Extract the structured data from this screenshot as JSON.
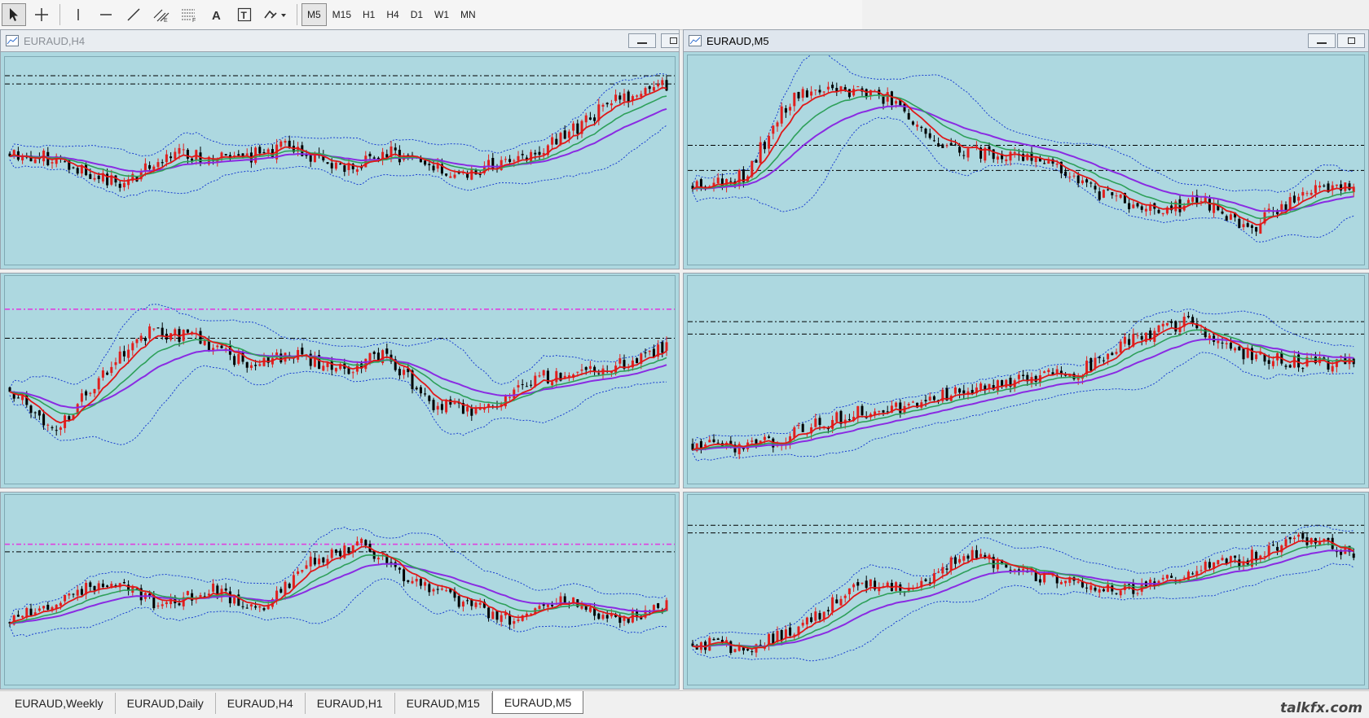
{
  "toolbar": {
    "tools": [
      {
        "name": "cursor-tool",
        "icon": "arrow-cursor-icon",
        "active": true
      },
      {
        "name": "crosshair-tool",
        "icon": "crosshair-icon",
        "active": false
      },
      {
        "name": "vertical-line-tool",
        "icon": "vertical-line-icon",
        "active": false
      },
      {
        "name": "horizontal-line-tool",
        "icon": "horizontal-line-icon",
        "active": false
      },
      {
        "name": "trendline-tool",
        "icon": "trendline-icon",
        "active": false
      },
      {
        "name": "equidistant-channel-tool",
        "icon": "channel-icon",
        "active": false
      },
      {
        "name": "fibonacci-tool",
        "icon": "fibonacci-icon",
        "active": false
      },
      {
        "name": "text-tool",
        "icon": "text-a-icon",
        "active": false
      },
      {
        "name": "text-label-tool",
        "icon": "text-label-icon",
        "active": false
      },
      {
        "name": "shapes-menu-tool",
        "icon": "shapes-dropdown-icon",
        "active": false
      }
    ],
    "timeframes": [
      "M5",
      "M15",
      "H1",
      "H4",
      "D1",
      "W1",
      "MN"
    ],
    "active_timeframe": "M5"
  },
  "windows": [
    {
      "id": "w1",
      "title": "EURAUD,H4",
      "dim": true
    },
    {
      "id": "w2",
      "title": "EURAUD,M5",
      "dim": false
    }
  ],
  "tabs": [
    "EURAUD,Weekly",
    "EURAUD,Daily",
    "EURAUD,H4",
    "EURAUD,H1",
    "EURAUD,M15",
    "EURAUD,M5"
  ],
  "active_tab": "EURAUD,M5",
  "watermark": "talkfx.com",
  "colors": {
    "chart_bg": "#add8e0",
    "bull_candle": "#e0201e",
    "bear_candle": "#000000",
    "ma_fast": "#e01818",
    "ma_mid": "#2ea05a",
    "ma_slow": "#8a2be2",
    "bollinger": "#1a3fd0",
    "level_line": "#000000",
    "magenta_level": "#e040e0"
  },
  "chart_data": [
    {
      "type": "candlestick",
      "window": "top-left",
      "seed": 11,
      "trend": [
        0.55,
        0.5,
        0.35,
        0.55,
        0.5,
        0.58,
        0.45,
        0.55,
        0.42,
        0.48,
        0.62,
        0.85,
        0.95
      ],
      "levels": [
        0.09,
        0.13
      ],
      "magenta": []
    },
    {
      "type": "candlestick",
      "window": "top-right",
      "seed": 23,
      "trend": [
        0.35,
        0.4,
        0.9,
        0.92,
        0.85,
        0.55,
        0.55,
        0.5,
        0.3,
        0.2,
        0.25,
        0.1,
        0.3,
        0.35
      ],
      "levels": [
        0.43,
        0.55
      ],
      "magenta": []
    },
    {
      "type": "candlestick",
      "window": "middle-left",
      "seed": 37,
      "trend": [
        0.45,
        0.2,
        0.55,
        0.8,
        0.75,
        0.6,
        0.65,
        0.55,
        0.65,
        0.35,
        0.3,
        0.5,
        0.55,
        0.6,
        0.7
      ],
      "levels": [
        0.3
      ],
      "magenta": [
        0.16
      ]
    },
    {
      "type": "candlestick",
      "window": "middle-right",
      "seed": 41,
      "trend": [
        0.1,
        0.08,
        0.2,
        0.3,
        0.35,
        0.45,
        0.5,
        0.55,
        0.75,
        0.85,
        0.65,
        0.6,
        0.6
      ],
      "levels": [
        0.22,
        0.28
      ],
      "magenta": []
    },
    {
      "type": "candlestick",
      "window": "bottom-left",
      "seed": 53,
      "trend": [
        0.3,
        0.45,
        0.55,
        0.4,
        0.5,
        0.35,
        0.7,
        0.8,
        0.55,
        0.4,
        0.3,
        0.45,
        0.3,
        0.4
      ],
      "levels": [
        0.3
      ],
      "magenta": [
        0.26
      ]
    },
    {
      "type": "candlestick",
      "window": "bottom-right",
      "seed": 67,
      "trend": [
        0.15,
        0.12,
        0.25,
        0.55,
        0.5,
        0.75,
        0.6,
        0.55,
        0.5,
        0.62,
        0.7,
        0.85,
        0.75
      ],
      "levels": [
        0.16,
        0.2
      ],
      "magenta": []
    }
  ]
}
